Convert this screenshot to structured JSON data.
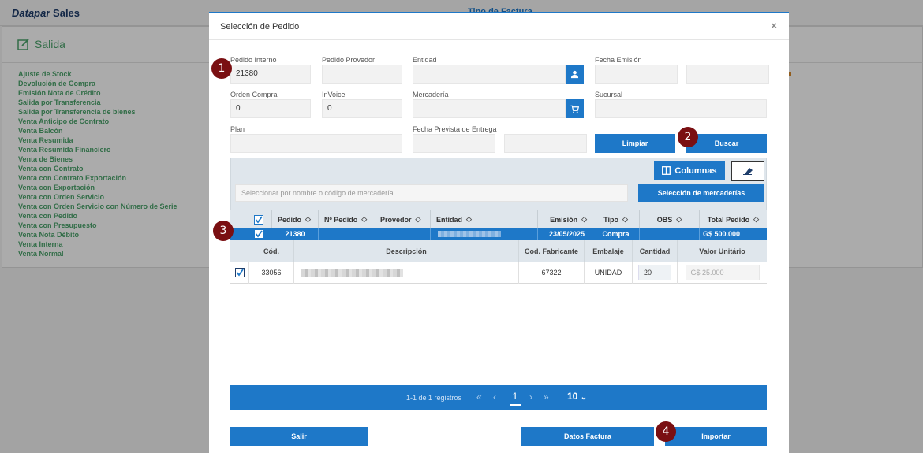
{
  "background": {
    "brand": "Datapar",
    "brand_suffix": "Sales",
    "tipo_factura": "Tipo de Factura",
    "section_title": "Salida",
    "menu": [
      "Ajuste de Stock",
      "Devolución de Compra",
      "Emisión Nota de Crédito",
      "Salida por Transferencia",
      "Salida por Transferencia de bienes",
      "Venta Anticipo de Contrato",
      "Venta Balcón",
      "Venta Resumida",
      "Venta Resumida Financiero",
      "Venta de Bienes",
      "Venta con Contrato",
      "Venta con Contrato Exportación",
      "Venta con Exportación",
      "Venta con Orden Servicio",
      "Venta con Orden Servicio con Número de Serie",
      "Venta con Pedido",
      "Venta con Presupuesto",
      "Venta Nota Débito",
      "Venta Interna",
      "Venta Normal"
    ]
  },
  "modal": {
    "title": "Selección de Pedido",
    "close": "×",
    "fields": {
      "pedido_interno": {
        "label": "Pedido Interno",
        "value": "21380"
      },
      "pedido_proveedor": {
        "label": "Pedido Provedor",
        "value": ""
      },
      "entidad": {
        "label": "Entidad",
        "value": ""
      },
      "fecha_emision": {
        "label": "Fecha Emisión",
        "value": ""
      },
      "orden_compra": {
        "label": "Orden Compra",
        "value": "0"
      },
      "invoice": {
        "label": "InVoice",
        "value": "0"
      },
      "mercaderia": {
        "label": "Mercadería",
        "value": ""
      },
      "sucursal": {
        "label": "Sucursal",
        "value": ""
      },
      "plan": {
        "label": "Plan",
        "value": ""
      },
      "fecha_prevista": {
        "label": "Fecha Prevista de Entrega",
        "value": ""
      }
    },
    "buttons": {
      "limpiar": "Limpiar",
      "buscar": "Buscar",
      "columnas": "Columnas",
      "seleccion_mercaderias": "Selección de mercaderías",
      "salir": "Salir",
      "datos_factura": "Datos Factura",
      "importar": "Importar"
    },
    "search_placeholder": "Seleccionar por nombre o código de mercadería",
    "table": {
      "headers": [
        "Pedido",
        "Nº Pedido",
        "Provedor",
        "Entidad",
        "Emisión",
        "Tipo",
        "OBS",
        "Total Pedido"
      ],
      "row": {
        "pedido": "21380",
        "n_pedido": "",
        "proveedor": "",
        "entidad": "",
        "emision": "23/05/2025",
        "tipo": "Compra",
        "obs": "",
        "total": "G$ 500.000"
      }
    },
    "subtable": {
      "headers": [
        "Cód.",
        "Descripción",
        "Cod. Fabricante",
        "Embalaje",
        "Cantidad",
        "Valor Unitário"
      ],
      "row": {
        "cod": "33056",
        "descripcion": "",
        "cod_fabricante": "67322",
        "embalaje": "UNIDAD",
        "cantidad": "20",
        "valor_unitario": "G$ 25.000"
      }
    },
    "pager": {
      "info": "1-1 de 1 registros",
      "first": "«",
      "prev": "‹",
      "page": "1",
      "next": "›",
      "last": "»",
      "page_size": "10"
    }
  },
  "badges": [
    "1",
    "2",
    "3",
    "4"
  ],
  "colors": {
    "accent": "#1e78c8",
    "badge": "#7a0f12",
    "green": "#4aa36b"
  }
}
